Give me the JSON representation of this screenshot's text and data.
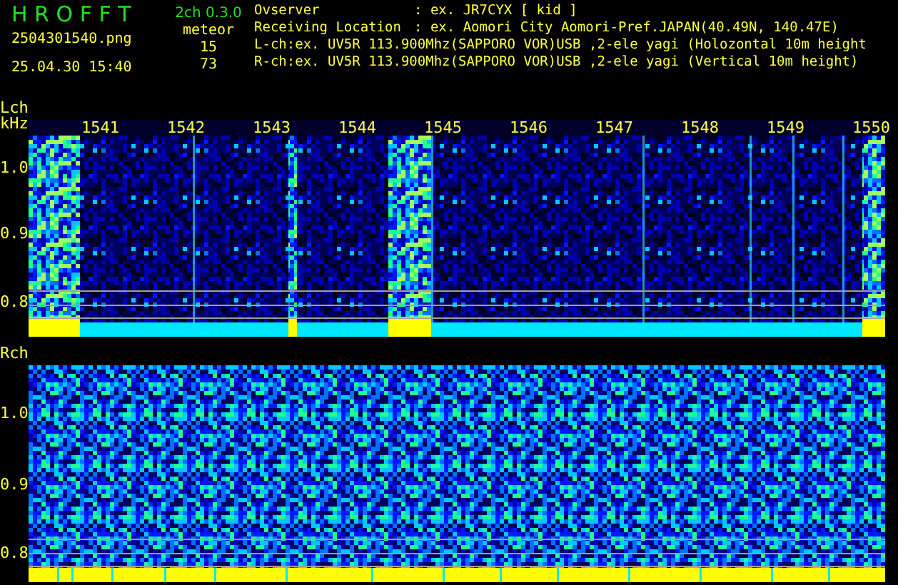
{
  "app": {
    "title": "H R O F F T",
    "version": "2ch 0.3.0",
    "filename": "2504301540.png",
    "datetime": "25.04.30 15:40",
    "meteor_label": "meteor",
    "meteor_counts": [
      "15",
      "73"
    ]
  },
  "info": [
    {
      "label": "Ovserver",
      "value": ": ex. JR7CYX [ kid ]"
    },
    {
      "label": "Receiving Location",
      "value": ": ex. Aomori City Aomori-Pref.JAPAN(40.49N, 140.47E)"
    },
    {
      "label": "L-ch:ex. UV5R 113.900Mhz(SAPPORO VOR)USB ,2-ele yagi (Holozontal 10m height"
    },
    {
      "label": "R-ch:ex. UV5R 113.900Mhz(SAPPORO VOR)USB ,2-ele yagi (Vertical 10m height)"
    }
  ],
  "channels": [
    {
      "label": "Lch",
      "unit": "kHz",
      "time_labels": [
        "1541",
        "1542",
        "1543",
        "1544",
        "1545",
        "1546",
        "1547",
        "1548",
        "1549",
        "1550"
      ],
      "y_labels": [
        "1.0",
        "0.9",
        "0.8"
      ]
    },
    {
      "label": "Rch",
      "y_labels": [
        "1.0",
        "0.9",
        "0.8"
      ]
    }
  ]
}
